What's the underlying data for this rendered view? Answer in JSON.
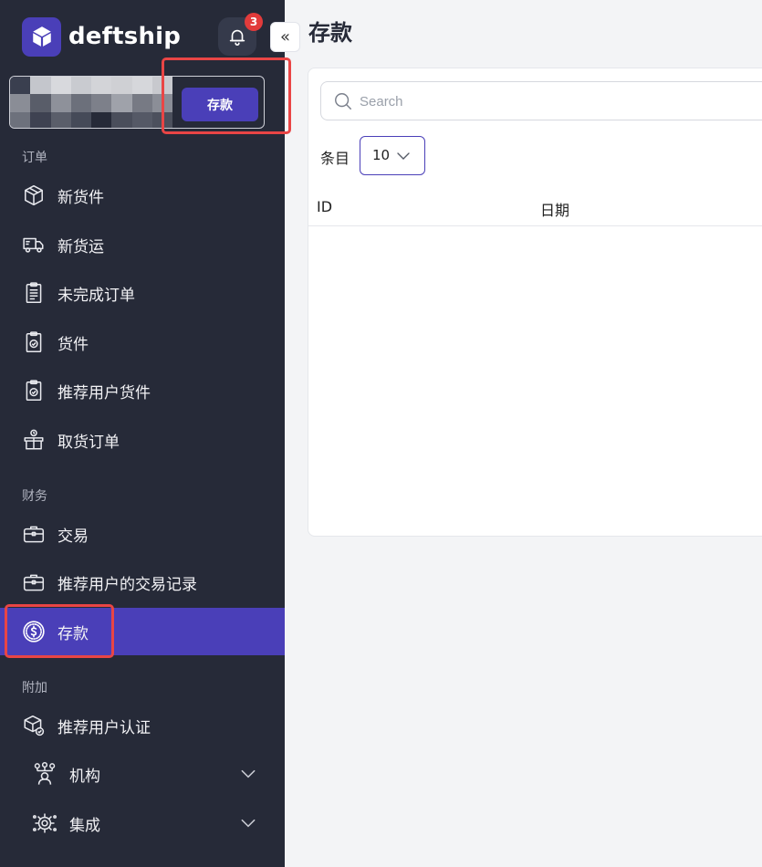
{
  "brand": {
    "name": "deftship"
  },
  "notifications": {
    "count": "3"
  },
  "account": {
    "deposit_label": "存款"
  },
  "collapse": {
    "glyph": "«"
  },
  "sidebar": {
    "sections": [
      {
        "title": "订单"
      },
      {
        "title": "财务"
      },
      {
        "title": "附加"
      }
    ],
    "items": [
      {
        "label": "新货件",
        "icon": "package-icon"
      },
      {
        "label": "新货运",
        "icon": "truck-icon"
      },
      {
        "label": "未完成订单",
        "icon": "clipboard-list-icon"
      },
      {
        "label": "货件",
        "icon": "clipboard-check-icon"
      },
      {
        "label": "推荐用户货件",
        "icon": "clipboard-check-icon"
      },
      {
        "label": "取货订单",
        "icon": "pickup-box-icon"
      },
      {
        "label": "交易",
        "icon": "briefcase-icon"
      },
      {
        "label": "推荐用户的交易记录",
        "icon": "briefcase-icon"
      },
      {
        "label": "存款",
        "icon": "dollar-circle-icon",
        "active": true
      },
      {
        "label": "推荐用户认证",
        "icon": "verified-box-icon"
      },
      {
        "label": "机构",
        "icon": "organization-icon"
      },
      {
        "label": "集成",
        "icon": "integration-gear-icon"
      }
    ]
  },
  "main": {
    "title": "存款",
    "search": {
      "placeholder": "Search",
      "value": ""
    },
    "entries": {
      "label": "条目",
      "value": "10"
    },
    "table": {
      "columns": [
        "ID",
        "日期"
      ]
    }
  },
  "colors": {
    "sidebar_bg": "#262a38",
    "accent": "#4a3fb8",
    "highlight": "#e94545"
  }
}
